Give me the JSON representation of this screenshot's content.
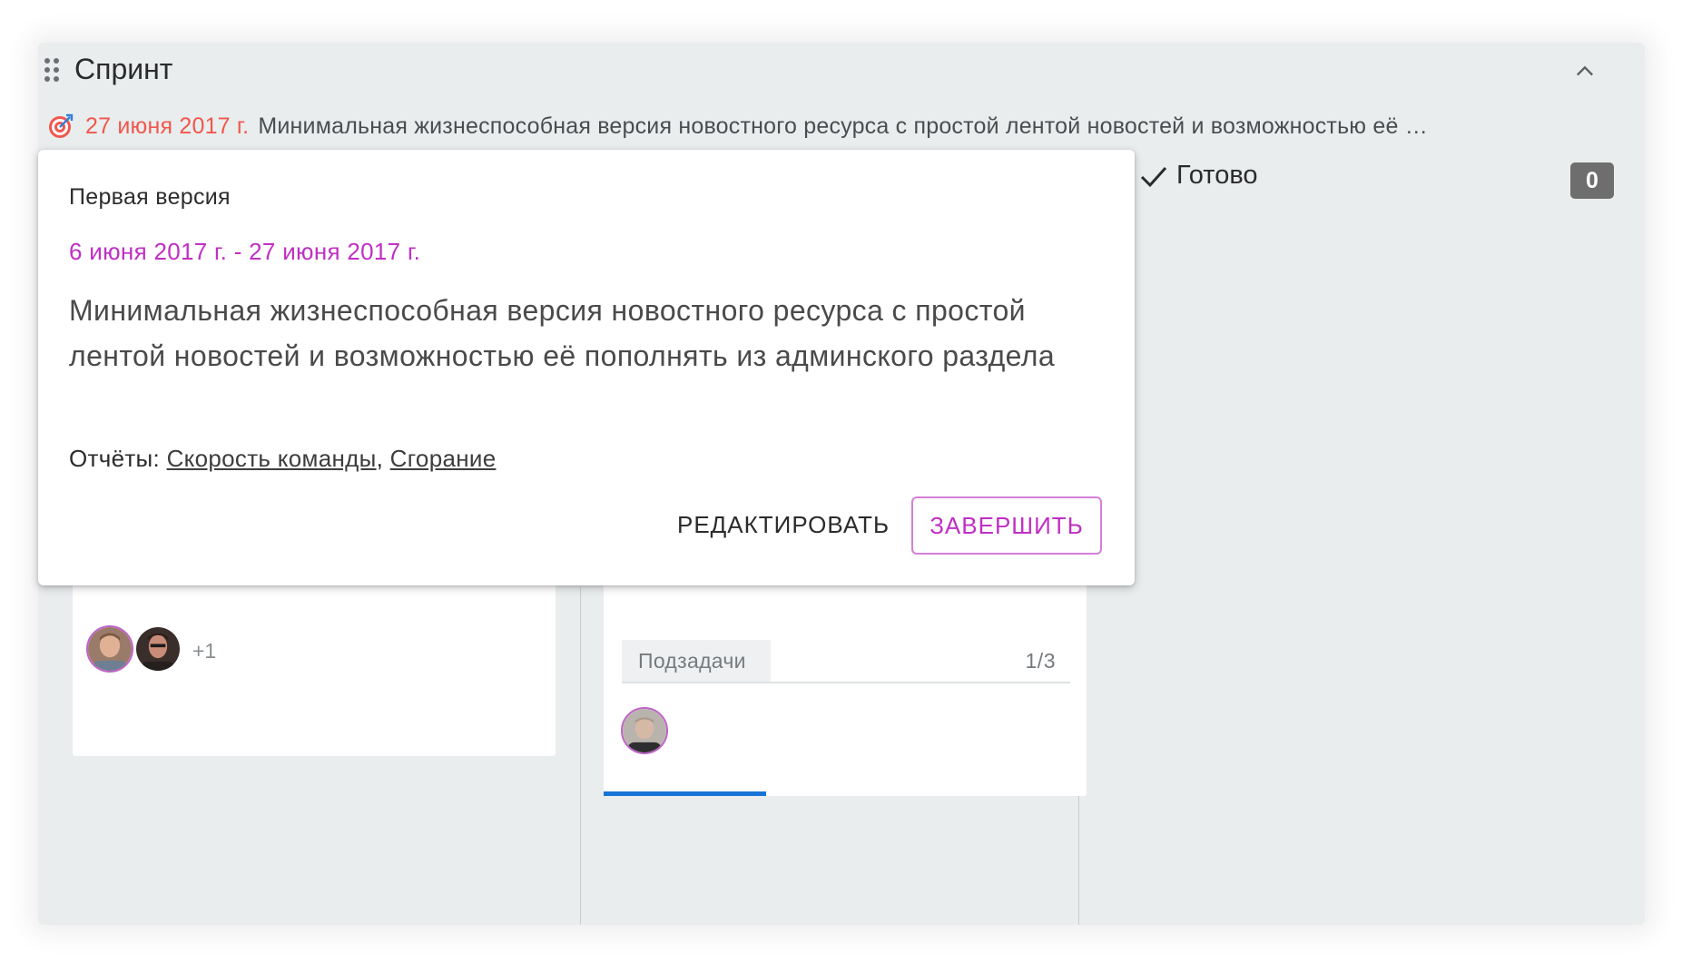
{
  "sprint": {
    "title": "Спринт",
    "goal_date": "27 июня 2017 г.",
    "goal_text": "Минимальная жизнеспособная версия новостного ресурса с простой лентой новостей и возможностью её …"
  },
  "columns": {
    "done": {
      "label": "Готово",
      "count": "0"
    }
  },
  "cards": {
    "left": {
      "extra_assignees": "+1"
    },
    "middle": {
      "subtasks_label": "Подзадачи",
      "subtasks_count": "1/3"
    }
  },
  "popover": {
    "title": "Первая версия",
    "dates": "6 июня 2017 г. - 27 июня 2017 г.",
    "description": "Минимальная жизнеспособная версия новостного ресурса с простой лентой новостей и возможностью её пополнять из админского раздела",
    "reports_label": "Отчёты:",
    "report_links": [
      "Скорость команды",
      "Сгорание"
    ],
    "edit_label": "РЕДАКТИРОВАТЬ",
    "finish_label": "ЗАВЕРШИТЬ"
  },
  "icons": {
    "drag": "drag-handle-icon",
    "collapse": "chevron-up-icon",
    "goal": "target-icon",
    "done": "check-icon"
  },
  "colors": {
    "goal_date": "#f0574d",
    "accent": "#c02fc4",
    "progress": "#1874d6",
    "board_bg": "#e9edee"
  }
}
